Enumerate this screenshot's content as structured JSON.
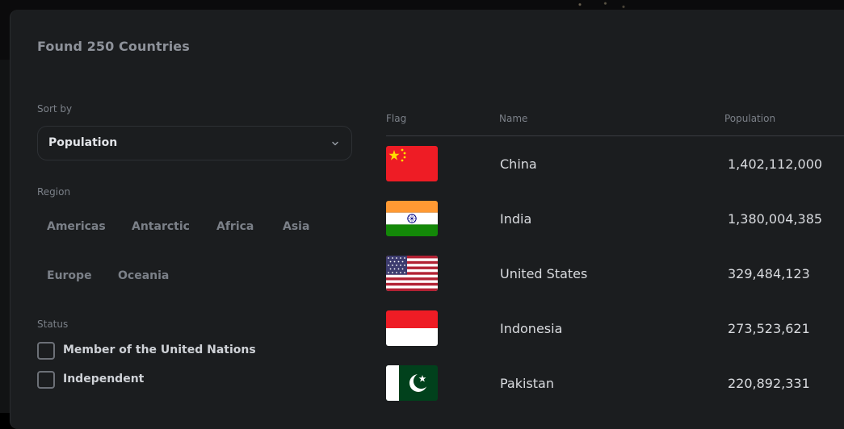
{
  "header": {
    "found_text": "Found 250 Countries"
  },
  "sort": {
    "label": "Sort by",
    "value": "Population"
  },
  "region": {
    "label": "Region",
    "options": [
      "Americas",
      "Antarctic",
      "Africa",
      "Asia",
      "Europe",
      "Oceania"
    ]
  },
  "status": {
    "label": "Status",
    "options": [
      {
        "label": "Member of the United Nations",
        "checked": false
      },
      {
        "label": "Independent",
        "checked": false
      }
    ]
  },
  "table": {
    "columns": [
      "Flag",
      "Name",
      "Population"
    ],
    "rows": [
      {
        "flag": "china-flag",
        "name": "China",
        "population": "1,402,112,000"
      },
      {
        "flag": "india-flag",
        "name": "India",
        "population": "1,380,004,385"
      },
      {
        "flag": "usa-flag",
        "name": "United States",
        "population": "329,484,123"
      },
      {
        "flag": "indonesia-flag",
        "name": "Indonesia",
        "population": "273,523,621"
      },
      {
        "flag": "pakistan-flag",
        "name": "Pakistan",
        "population": "220,892,331"
      }
    ]
  },
  "colors": {
    "panel_bg": "#1b1d1f",
    "muted_text": "#7b8088",
    "primary_text": "#d9dbdf"
  }
}
